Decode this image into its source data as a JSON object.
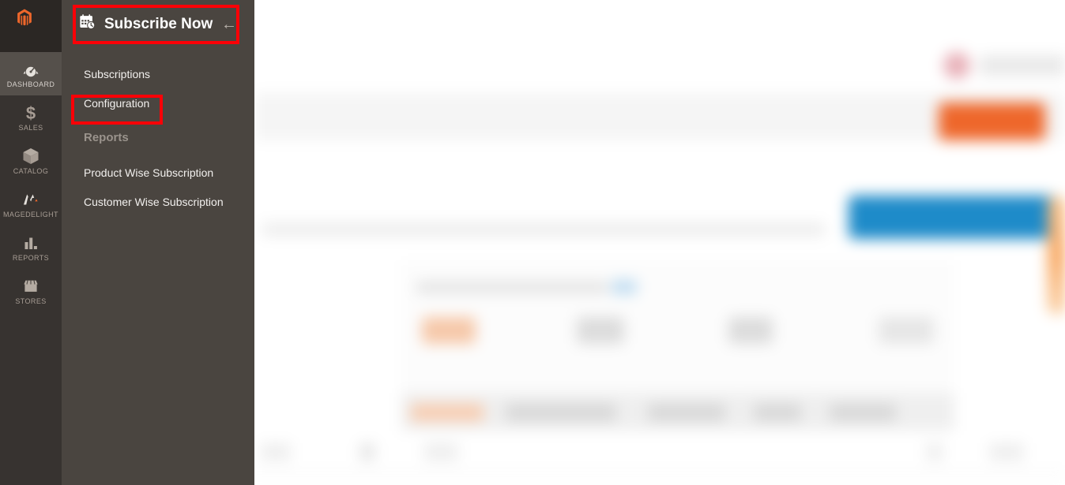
{
  "app": {
    "logo_icon": "magento-logo-icon",
    "brand_color": "#ee672b"
  },
  "sidebar": {
    "items": [
      {
        "label": "DASHBOARD",
        "icon": "gauge-icon",
        "active": true
      },
      {
        "label": "SALES",
        "icon": "dollar-icon",
        "active": false
      },
      {
        "label": "CATALOG",
        "icon": "box-icon",
        "active": false
      },
      {
        "label": "MAGEDELIGHT",
        "icon": "magedelight-icon",
        "active": false
      },
      {
        "label": "REPORTS",
        "icon": "bar-chart-icon",
        "active": false
      },
      {
        "label": "STORES",
        "icon": "storefront-icon",
        "active": false
      }
    ]
  },
  "submenu": {
    "title": "Subscribe Now",
    "title_icon": "calendar-clock-icon",
    "back_arrow": "←",
    "items": [
      {
        "label": "Subscriptions",
        "type": "link",
        "highlighted": false
      },
      {
        "label": "Configuration",
        "type": "link",
        "highlighted": true
      },
      {
        "label": "Reports",
        "type": "heading",
        "highlighted": false
      },
      {
        "label": "Product Wise Subscription",
        "type": "link",
        "highlighted": false
      },
      {
        "label": "Customer Wise Subscription",
        "type": "link",
        "highlighted": false
      }
    ]
  },
  "annotations": {
    "color": "#fb0007",
    "boxes": [
      {
        "name": "subscribe-now-title",
        "target": "Subscribe Now"
      },
      {
        "name": "configuration-item",
        "target": "Configuration"
      }
    ]
  },
  "background": {
    "state": "blurred",
    "description": "Magento admin dashboard page behind the open flyout menu",
    "accent_colors": {
      "orange_button": "#ee672b",
      "blue_banner": "#1e8bc9",
      "notification": "#e8b0b8",
      "orange_edge": "#f8a55d"
    }
  }
}
